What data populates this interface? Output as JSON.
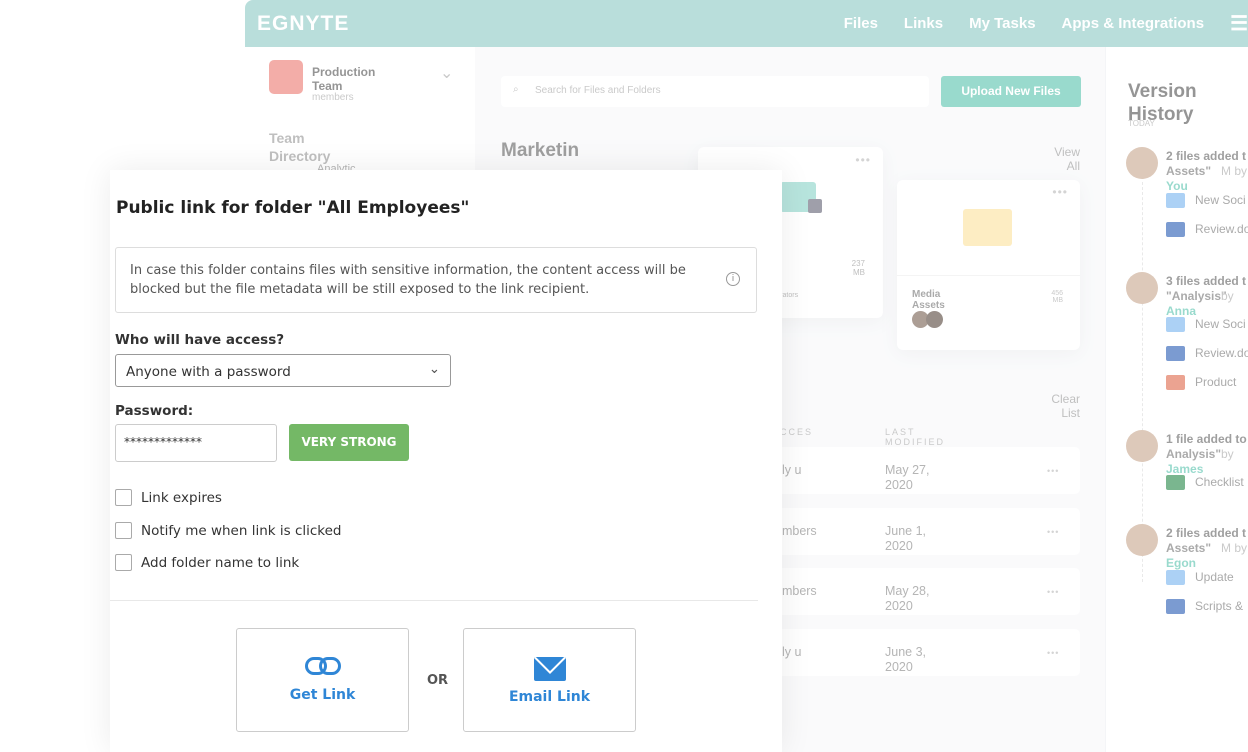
{
  "app": {
    "logo": "EGNYTE",
    "nav": [
      "Files",
      "Links",
      "My Tasks",
      "Apps & Integrations"
    ],
    "sidebar": {
      "team_name": "Production Team",
      "team_sub": "members",
      "section": "Team Directory",
      "item": "Analytic"
    },
    "search_placeholder": "Search for Files and Folders",
    "upload_label": "Upload New Files",
    "main_title": "Marketin",
    "view_all": "View All",
    "clear_list": "Clear List",
    "cards": [
      {
        "size": "237 MB",
        "collab": "more collaborators"
      },
      {
        "name": "Media Assets",
        "size": "456 MB"
      }
    ],
    "columns": [
      "CCES",
      "LAST MODIFIED"
    ],
    "rows": [
      {
        "access": "nly u",
        "date": "May 27, 2020"
      },
      {
        "access": "embers",
        "date": "June 1, 2020"
      },
      {
        "access": "embers",
        "date": "May 28, 2020"
      },
      {
        "access": "nly u",
        "date": "June 3, 2020"
      }
    ],
    "version_history": {
      "title": "Version History",
      "today": "TODAY",
      "events": [
        {
          "title": "2 files added t",
          "folder": "Assets\"",
          "time": "M by",
          "user": "You",
          "files": [
            "New Soci",
            "Review.do"
          ]
        },
        {
          "title": "3 files added t",
          "folder": "\"Analysis\"",
          "time": "by",
          "user": "Anna",
          "files": [
            "New Soci",
            "Review.do",
            "Product"
          ]
        },
        {
          "title": "1 file added to",
          "folder": "Analysis\"",
          "time": "by",
          "user": "James",
          "files": [
            "Checklist"
          ]
        },
        {
          "title": "2 files added t",
          "folder": "Assets\"",
          "time": "M by",
          "user": "Egon",
          "files": [
            "Update",
            "Scripts &"
          ]
        }
      ]
    },
    "colors": {
      "header": "#8fcbc6",
      "accent": "#5cc5b0"
    }
  },
  "dialog": {
    "title": "Public link for folder \"All Employees\"",
    "info": "In case this folder contains files with sensitive information, the content access will be blocked but the file metadata will be still exposed to the link recipient.",
    "access_label": "Who will have access?",
    "access_value": "Anyone with a password",
    "password_label": "Password:",
    "password_value": "*************",
    "strength": "VERY STRONG",
    "options": [
      {
        "label": "Link expires",
        "checked": false
      },
      {
        "label": "Notify me when link is clicked",
        "checked": false
      },
      {
        "label": "Add folder name to link",
        "checked": false
      }
    ],
    "get_link": "Get Link",
    "or": "OR",
    "email_link": "Email Link",
    "colors": {
      "strength": "#74b866",
      "link": "#2f86d6"
    }
  }
}
